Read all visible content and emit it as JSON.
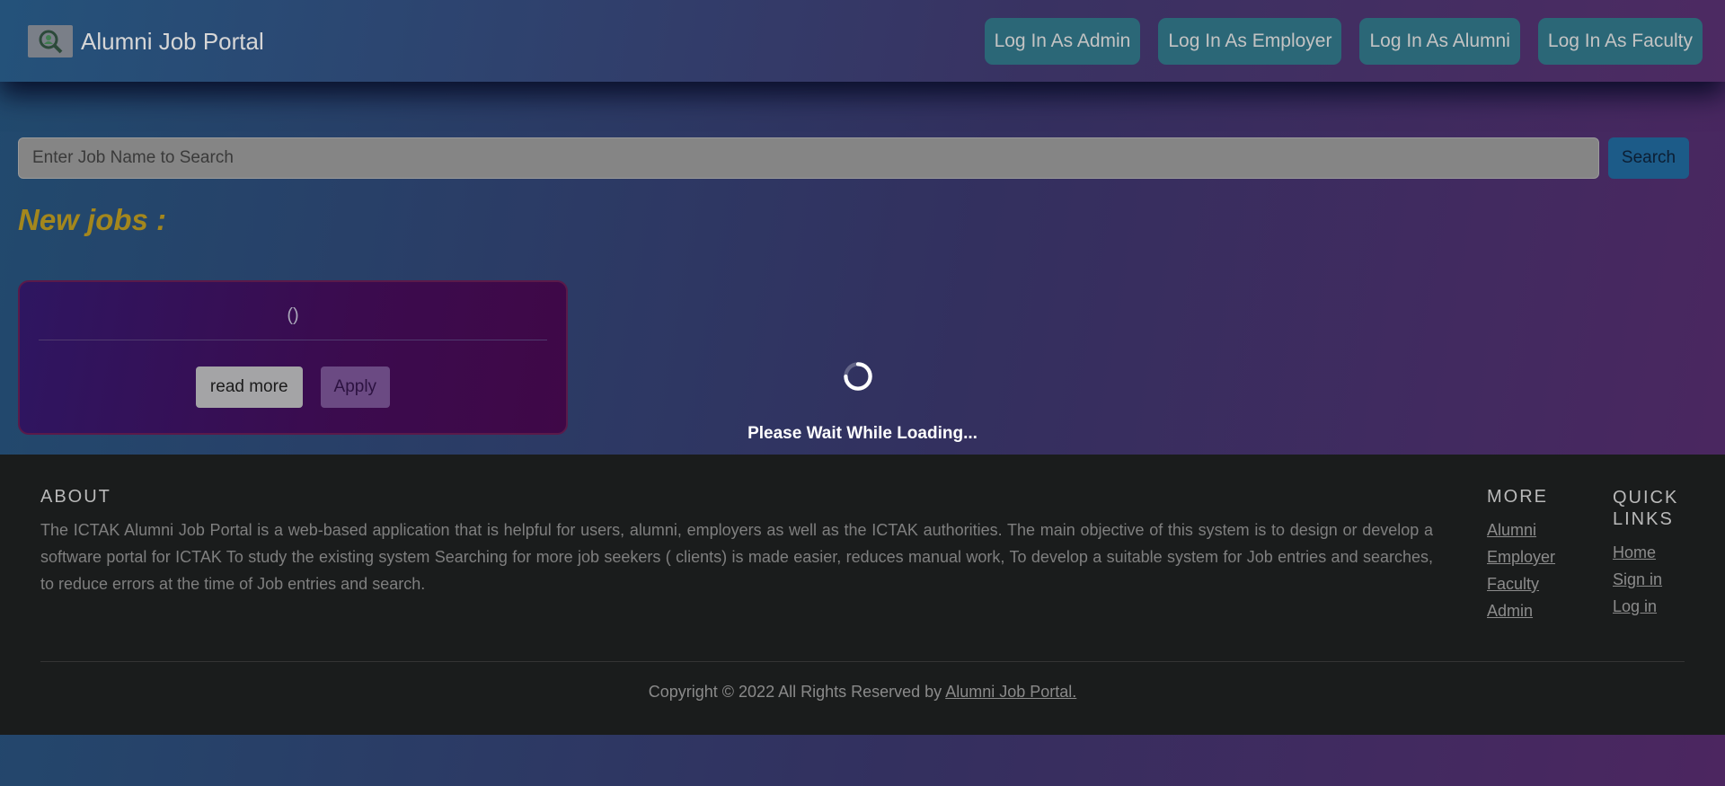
{
  "navbar": {
    "brand": "Alumni Job Portal",
    "buttons": [
      "Log In As Admin",
      "Log In As Employer",
      "Log In As Alumni",
      "Log In As Faculty"
    ]
  },
  "search": {
    "placeholder": "Enter Job Name to Search",
    "button": "Search"
  },
  "jobs": {
    "heading": "New jobs :",
    "card": {
      "title": "()",
      "read_more": "read more",
      "apply": "Apply"
    }
  },
  "loading": {
    "text": "Please Wait While Loading..."
  },
  "footer": {
    "about_heading": "ABOUT",
    "about_text": "The ICTAK Alumni Job Portal is a web-based application that is helpful for users, alumni, employers as well as the ICTAK authorities. The main objective of this system is to design or develop a software portal for ICTAK To study the existing system Searching for more job seekers ( clients) is made easier, reduces manual work, To develop a suitable system for Job entries and searches, to reduce errors at the time of Job entries and search.",
    "more_heading": "MORE",
    "more_links": [
      "Alumni",
      "Employer",
      "Faculty",
      "Admin"
    ],
    "quick_heading": "QUICK LINKS",
    "quick_links": [
      "Home",
      "Sign in",
      "Log in"
    ],
    "copyright_prefix": "Copyright © 2022 All Rights Reserved by",
    "copyright_link": "Alumni Job Portal."
  },
  "colors": {
    "nav_button": "#2b6777",
    "heading_gold": "#a4871d",
    "footer_bg": "#1a1c1c",
    "search_button": "#1c5b88"
  },
  "icons": {
    "logo": "magnifier-person-logo",
    "loader": "loading-spinner-icon"
  }
}
